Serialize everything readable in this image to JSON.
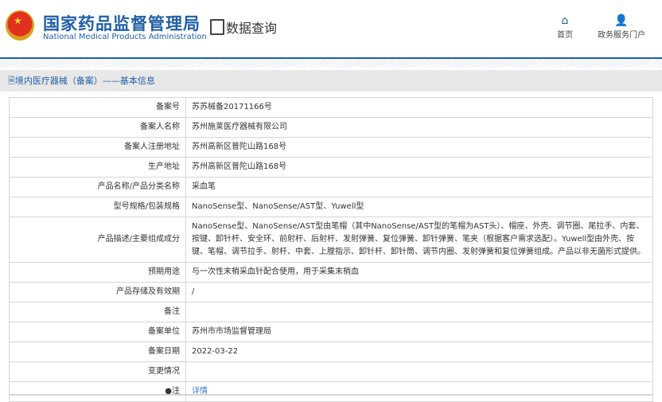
{
  "header": {
    "title_cn": "国家药品监督管理局",
    "title_en": "National Medical Products Administration",
    "query_label": "数据查询",
    "nav": [
      {
        "label": "首页",
        "icon": "home-icon"
      },
      {
        "label": "政务服务门户",
        "icon": "user-icon"
      }
    ]
  },
  "breadcrumb": "境内医疗器械（备案）——基本信息",
  "rows": [
    {
      "label": "备案号",
      "value": "苏苏械备20171166号"
    },
    {
      "label": "备案人名称",
      "value": "苏州施莱医疗器械有限公司"
    },
    {
      "label": "备案人注册地址",
      "value": "苏州高新区普陀山路168号"
    },
    {
      "label": "生产地址",
      "value": "苏州高新区普陀山路168号"
    },
    {
      "label": "产品名称/产品分类名称",
      "value": "采血笔"
    },
    {
      "label": "型号规格/包装规格",
      "value": "NanoSense型、NanoSense/AST型、Yuwell型"
    },
    {
      "label": "产品描述/主要组成成分",
      "value": "NanoSense型、NanoSense/AST型由笔帽（其中NanoSense/AST型的笔帽为AST头）、帽座、外壳、调节圈、尾拉手、内套、按键、卸针杆、安全环、前射杆、后射杆、发射弹簧、复位弹簧、卸针弹簧、笔夹（根据客户需求选配）。Yuwell型由外壳、按键、笔帽、调节拉手、射杆、中套、上膛指示、卸针杆、卸针筒、调节内圈、发射弹簧和复位弹簧组成。产品以非无菌形式提供。"
    },
    {
      "label": "预期用途",
      "value": "与一次性末梢采血针配合使用，用于采集末梢血"
    },
    {
      "label": "产品存储及有效期",
      "value": "/"
    },
    {
      "label": "备注",
      "value": ""
    },
    {
      "label": "备案单位",
      "value": "苏州市市场监督管理局"
    },
    {
      "label": "备案日期",
      "value": "2022-03-22"
    },
    {
      "label": "变更情况",
      "value": ""
    }
  ],
  "note": {
    "label": "注",
    "icon": "pin-icon",
    "link": "详情"
  },
  "colors": {
    "brand": "#1f5fa6",
    "link": "#3a7fd0"
  }
}
